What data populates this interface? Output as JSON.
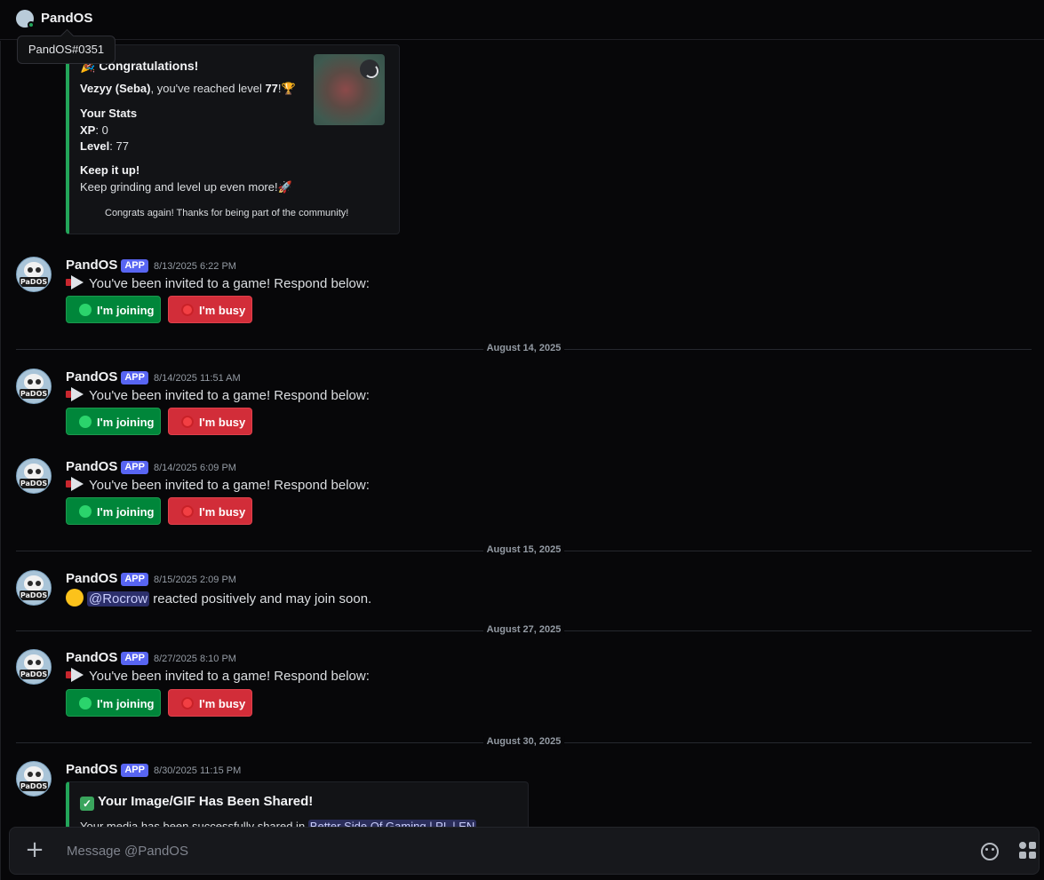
{
  "header": {
    "title": "PandOS",
    "tooltip": "PandOS#0351",
    "status_color": "#23a55a"
  },
  "embed_level": {
    "title": "Congratulations!",
    "user": "Vezyy (Seba)",
    "line_mid": ", you've reached level ",
    "level_num": "77",
    "line_end": "!",
    "stats_heading": "Your Stats",
    "xp_label": "XP",
    "xp_value": ": 0",
    "level_label": "Level",
    "level_value": ": 77",
    "keep_heading": "Keep it up!",
    "keep_text": "Keep grinding and level up even more!",
    "footer": "Congrats again! Thanks for being part of the community!",
    "accent": "#23a55a"
  },
  "messages": [
    {
      "author": "PandOS",
      "badge": "APP",
      "timestamp": "8/13/2025 6:22 PM",
      "text": "You've been invited to a game! Respond below:",
      "join_label": "I'm joining",
      "busy_label": "I'm busy"
    },
    {
      "author": "PandOS",
      "badge": "APP",
      "timestamp": "8/14/2025 11:51 AM",
      "text": "You've been invited to a game! Respond below:",
      "join_label": "I'm joining",
      "busy_label": "I'm busy"
    },
    {
      "author": "PandOS",
      "badge": "APP",
      "timestamp": "8/14/2025 6:09 PM",
      "text": "You've been invited to a game! Respond below:",
      "join_label": "I'm joining",
      "busy_label": "I'm busy"
    },
    {
      "author": "PandOS",
      "badge": "APP",
      "timestamp": "8/15/2025 2:09 PM",
      "mention": "@Rocrow",
      "text": " reacted positively and may join soon."
    },
    {
      "author": "PandOS",
      "badge": "APP",
      "timestamp": "8/27/2025 8:10 PM",
      "text": "You've been invited to a game! Respond below:",
      "join_label": "I'm joining",
      "busy_label": "I'm busy"
    },
    {
      "author": "PandOS",
      "badge": "APP",
      "timestamp": "8/30/2025 11:15 PM"
    }
  ],
  "dividers": [
    "August 14, 2025",
    "August 15, 2025",
    "August 27, 2025",
    "August 30, 2025"
  ],
  "embed_share": {
    "title": "Your Image/GIF Has Been Shared!",
    "text": "Your media has been successfully shared in ",
    "channel": "Better Side Of Gaming | PL | EN"
  },
  "avatar_tag": "PaDOS",
  "composer": {
    "placeholder": "Message @PandOS"
  },
  "colors": {
    "join": "#00863a",
    "busy": "#d22d39",
    "app_badge": "#5865f2"
  }
}
